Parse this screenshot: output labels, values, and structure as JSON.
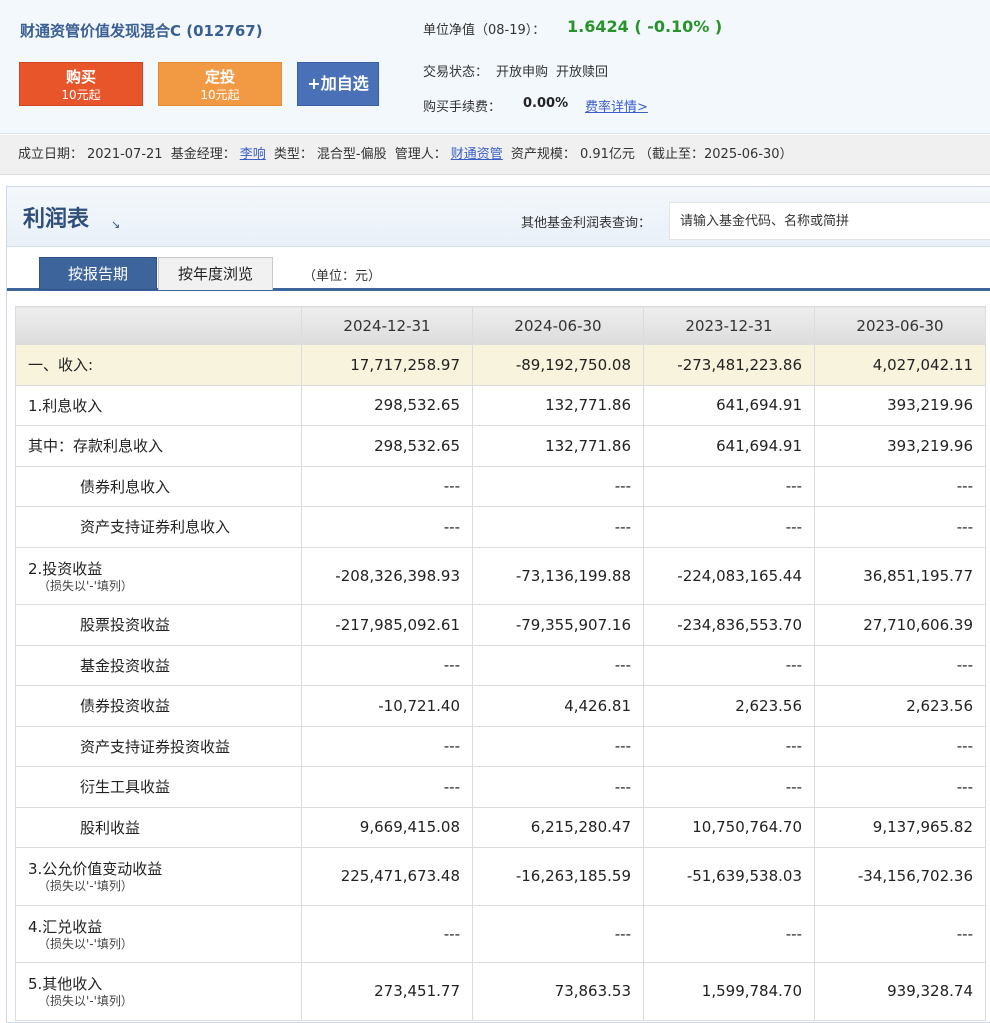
{
  "fund": {
    "name": "财通资管价值发现混合C (012767)",
    "buy": {
      "label": "购买",
      "sub": "10元起"
    },
    "sip": {
      "label": "定投",
      "sub": "10元起"
    },
    "fav": {
      "label": "+加自选"
    },
    "nav_label": "单位净值（08-19）：",
    "nav_value": "1.6424 ( -0.10% )",
    "trade_label": "交易状态：",
    "trade_status_1": "开放申购",
    "trade_status_2": "开放赎回",
    "fee_label": "购买手续费：",
    "fee_value": "0.00%",
    "fee_link": "费率详情>",
    "colors": {
      "buy": "#e8552a",
      "sip": "#f29a43",
      "fav": "#4a70b8",
      "nav_up_down": "#27932a"
    }
  },
  "info": {
    "setup_label": "成立日期：",
    "setup_date": "2021-07-21",
    "manager_label": "基金经理：",
    "manager": "李响",
    "type_label": "类型：",
    "type": "混合型-偏股",
    "admin_label": "管理人：",
    "admin": "财通资管",
    "scale_label": "资产规模：",
    "scale": "0.91亿元 （截止至：2025-06-30）"
  },
  "section": {
    "title": "利润表",
    "query_label": "其他基金利润表查询：",
    "query_placeholder": "请输入基金代码、名称或简拼",
    "tabs": [
      "按报告期",
      "按年度浏览"
    ],
    "unit": "（单位：元）"
  },
  "table": {
    "headers": [
      "",
      "2024-12-31",
      "2024-06-30",
      "2023-12-31",
      "2023-06-30"
    ],
    "rows": [
      {
        "label": "一、收入:",
        "sub": "",
        "values": [
          "17,717,258.97",
          "-89,192,750.08",
          "-273,481,223.86",
          "4,027,042.11"
        ]
      },
      {
        "label": "1.利息收入",
        "sub": "",
        "values": [
          "298,532.65",
          "132,771.86",
          "641,694.91",
          "393,219.96"
        ]
      },
      {
        "label": "其中：存款利息收入",
        "sub": "",
        "values": [
          "298,532.65",
          "132,771.86",
          "641,694.91",
          "393,219.96"
        ]
      },
      {
        "label": "债券利息收入",
        "sub": "",
        "values": [
          "---",
          "---",
          "---",
          "---"
        ]
      },
      {
        "label": "资产支持证券利息收入",
        "sub": "",
        "values": [
          "---",
          "---",
          "---",
          "---"
        ]
      },
      {
        "label": "2.投资收益",
        "sub": "（损失以'-'填列）",
        "values": [
          "-208,326,398.93",
          "-73,136,199.88",
          "-224,083,165.44",
          "36,851,195.77"
        ]
      },
      {
        "label": "股票投资收益",
        "sub": "",
        "values": [
          "-217,985,092.61",
          "-79,355,907.16",
          "-234,836,553.70",
          "27,710,606.39"
        ]
      },
      {
        "label": "基金投资收益",
        "sub": "",
        "values": [
          "---",
          "---",
          "---",
          "---"
        ]
      },
      {
        "label": "债券投资收益",
        "sub": "",
        "values": [
          "-10,721.40",
          "4,426.81",
          "2,623.56",
          "2,623.56"
        ]
      },
      {
        "label": "资产支持证券投资收益",
        "sub": "",
        "values": [
          "---",
          "---",
          "---",
          "---"
        ]
      },
      {
        "label": "衍生工具收益",
        "sub": "",
        "values": [
          "---",
          "---",
          "---",
          "---"
        ]
      },
      {
        "label": "股利收益",
        "sub": "",
        "values": [
          "9,669,415.08",
          "6,215,280.47",
          "10,750,764.70",
          "9,137,965.82"
        ]
      },
      {
        "label": "3.公允价值变动收益",
        "sub": "（损失以'-'填列）",
        "values": [
          "225,471,673.48",
          "-16,263,185.59",
          "-51,639,538.03",
          "-34,156,702.36"
        ]
      },
      {
        "label": "4.汇兑收益",
        "sub": "（损失以'-'填列）",
        "values": [
          "---",
          "---",
          "---",
          "---"
        ]
      },
      {
        "label": "5.其他收入",
        "sub": "（损失以'-'填列）",
        "values": [
          "273,451.77",
          "73,863.53",
          "1,599,784.70",
          "939,328.74"
        ]
      }
    ]
  }
}
